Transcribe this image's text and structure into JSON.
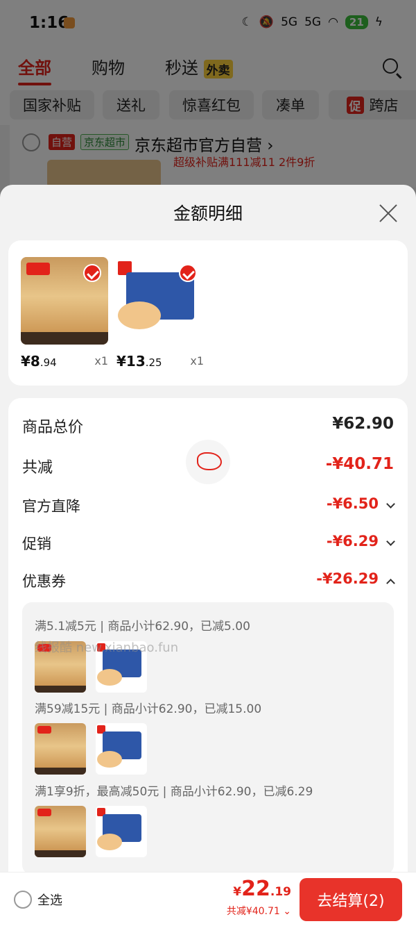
{
  "status_bar": {
    "time": "1:16",
    "network_1": "5G",
    "network_2": "5G",
    "battery": "21"
  },
  "top_nav": {
    "tabs": [
      "全部",
      "购物",
      "秒送"
    ],
    "waimai_badge": "外卖"
  },
  "filter_chips": [
    "国家补贴",
    "送礼",
    "惊喜红包",
    "凑单",
    "跨店"
  ],
  "filter_chip_badge": "促",
  "store": {
    "tag_self": "自营",
    "tag_supermarket": "京东超市",
    "name": "京东超市官方自营",
    "promo": "超级补贴满111减11  2件9折"
  },
  "sheet": {
    "title": "金额明细",
    "products": [
      {
        "price_int": "¥8",
        "price_dec": ".94",
        "qty": "x1"
      },
      {
        "price_int": "¥13",
        "price_dec": ".25",
        "qty": "x1"
      }
    ],
    "rows": {
      "subtotal_label": "商品总价",
      "subtotal_value": "¥62.90",
      "reduce_label": "共减",
      "reduce_value": "-¥40.71",
      "direct_label": "官方直降",
      "direct_value": "-¥6.50",
      "promo_label": "促销",
      "promo_value": "-¥6.29",
      "coupon_label": "优惠券",
      "coupon_value": "-¥26.29"
    },
    "coupons": [
      {
        "text": "满5.1减5元 | 商品小计62.90，已减5.00"
      },
      {
        "text": "满59减15元 | 商品小计62.90，已减15.00"
      },
      {
        "text": "满1享9折，最高减50元 | 商品小计62.90，已减6.29"
      }
    ],
    "watermark": "线报酷 new.xianbao.fun"
  },
  "bottom_bar": {
    "select_all": "全选",
    "total_yen": "¥",
    "total_int": "22",
    "total_dec": ".19",
    "saved": "共减¥40.71 ⌄",
    "checkout": "去结算(2)"
  },
  "colors": {
    "accent": "#e2231a",
    "checkout_bg": "#e8332a"
  }
}
